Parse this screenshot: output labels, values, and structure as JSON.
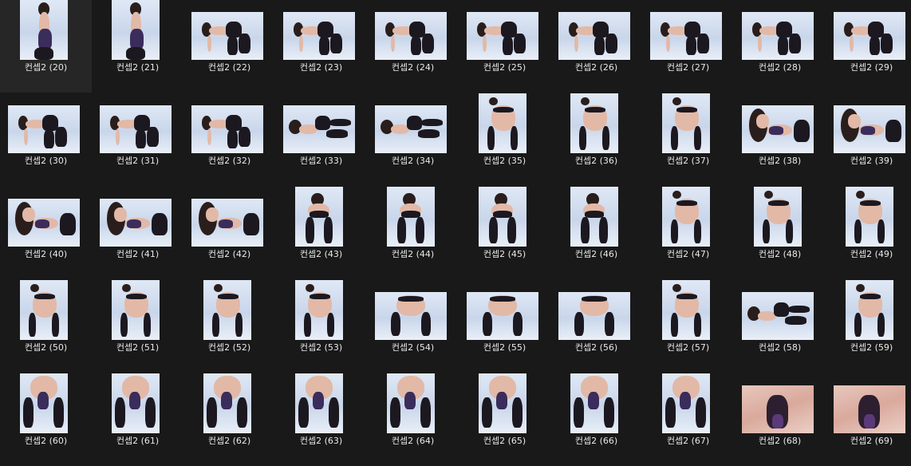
{
  "folder_view": {
    "files": [
      {
        "name": "컨셉2 (20)",
        "orientation": "portrait",
        "pose": "standing"
      },
      {
        "name": "컨셉2 (21)",
        "orientation": "portrait",
        "pose": "standing"
      },
      {
        "name": "컨셉2 (22)",
        "orientation": "landscape",
        "pose": "crawl-side"
      },
      {
        "name": "컨셉2 (23)",
        "orientation": "landscape",
        "pose": "crawl-side"
      },
      {
        "name": "컨셉2 (24)",
        "orientation": "landscape",
        "pose": "crawl-side"
      },
      {
        "name": "컨셉2 (25)",
        "orientation": "landscape",
        "pose": "crawl-side"
      },
      {
        "name": "컨셉2 (26)",
        "orientation": "landscape",
        "pose": "crawl-side"
      },
      {
        "name": "컨셉2 (27)",
        "orientation": "landscape",
        "pose": "crawl-side"
      },
      {
        "name": "컨셉2 (28)",
        "orientation": "landscape",
        "pose": "crawl-side"
      },
      {
        "name": "컨셉2 (29)",
        "orientation": "landscape",
        "pose": "crawl-side"
      },
      {
        "name": "컨셉2 (30)",
        "orientation": "landscape",
        "pose": "crawl-side"
      },
      {
        "name": "컨셉2 (31)",
        "orientation": "landscape",
        "pose": "crawl-side"
      },
      {
        "name": "컨셉2 (32)",
        "orientation": "landscape",
        "pose": "crawl-side"
      },
      {
        "name": "컨셉2 (33)",
        "orientation": "landscape",
        "pose": "lying"
      },
      {
        "name": "컨셉2 (34)",
        "orientation": "landscape",
        "pose": "lying"
      },
      {
        "name": "컨셉2 (35)",
        "orientation": "portrait",
        "pose": "back"
      },
      {
        "name": "컨셉2 (36)",
        "orientation": "portrait",
        "pose": "back"
      },
      {
        "name": "컨셉2 (37)",
        "orientation": "portrait",
        "pose": "back"
      },
      {
        "name": "컨셉2 (38)",
        "orientation": "landscape",
        "pose": "crawl-front"
      },
      {
        "name": "컨셉2 (39)",
        "orientation": "landscape",
        "pose": "crawl-front"
      },
      {
        "name": "컨셉2 (40)",
        "orientation": "landscape",
        "pose": "crawl-front"
      },
      {
        "name": "컨셉2 (41)",
        "orientation": "landscape",
        "pose": "crawl-front"
      },
      {
        "name": "컨셉2 (42)",
        "orientation": "landscape",
        "pose": "crawl-front"
      },
      {
        "name": "컨셉2 (43)",
        "orientation": "portrait",
        "pose": "bend"
      },
      {
        "name": "컨셉2 (44)",
        "orientation": "portrait",
        "pose": "bend"
      },
      {
        "name": "컨셉2 (45)",
        "orientation": "portrait",
        "pose": "bend"
      },
      {
        "name": "컨셉2 (46)",
        "orientation": "portrait",
        "pose": "bend"
      },
      {
        "name": "컨셉2 (47)",
        "orientation": "portrait",
        "pose": "back"
      },
      {
        "name": "컨셉2 (48)",
        "orientation": "portrait",
        "pose": "back"
      },
      {
        "name": "컨셉2 (49)",
        "orientation": "portrait",
        "pose": "back"
      },
      {
        "name": "컨셉2 (50)",
        "orientation": "portrait",
        "pose": "back"
      },
      {
        "name": "컨셉2 (51)",
        "orientation": "portrait",
        "pose": "back"
      },
      {
        "name": "컨셉2 (52)",
        "orientation": "portrait",
        "pose": "back"
      },
      {
        "name": "컨셉2 (53)",
        "orientation": "portrait",
        "pose": "back"
      },
      {
        "name": "컨셉2 (54)",
        "orientation": "landscape",
        "pose": "back-wide"
      },
      {
        "name": "컨셉2 (55)",
        "orientation": "landscape",
        "pose": "back-wide"
      },
      {
        "name": "컨셉2 (56)",
        "orientation": "landscape",
        "pose": "back-wide"
      },
      {
        "name": "컨셉2 (57)",
        "orientation": "portrait",
        "pose": "back"
      },
      {
        "name": "컨셉2 (58)",
        "orientation": "landscape",
        "pose": "lying"
      },
      {
        "name": "컨셉2 (59)",
        "orientation": "portrait",
        "pose": "back"
      },
      {
        "name": "컨셉2 (60)",
        "orientation": "portrait",
        "pose": "low"
      },
      {
        "name": "컨셉2 (61)",
        "orientation": "portrait",
        "pose": "low"
      },
      {
        "name": "컨셉2 (62)",
        "orientation": "portrait",
        "pose": "low"
      },
      {
        "name": "컨셉2 (63)",
        "orientation": "portrait",
        "pose": "low"
      },
      {
        "name": "컨셉2 (64)",
        "orientation": "portrait",
        "pose": "low"
      },
      {
        "name": "컨셉2 (65)",
        "orientation": "portrait",
        "pose": "low"
      },
      {
        "name": "컨셉2 (66)",
        "orientation": "portrait",
        "pose": "low"
      },
      {
        "name": "컨셉2 (67)",
        "orientation": "portrait",
        "pose": "low"
      },
      {
        "name": "컨셉2 (68)",
        "orientation": "landscape",
        "pose": "closeup"
      },
      {
        "name": "컨셉2 (69)",
        "orientation": "landscape",
        "pose": "closeup"
      }
    ]
  },
  "colors": {
    "background": "#191919",
    "label_text": "#e8e8e8"
  }
}
